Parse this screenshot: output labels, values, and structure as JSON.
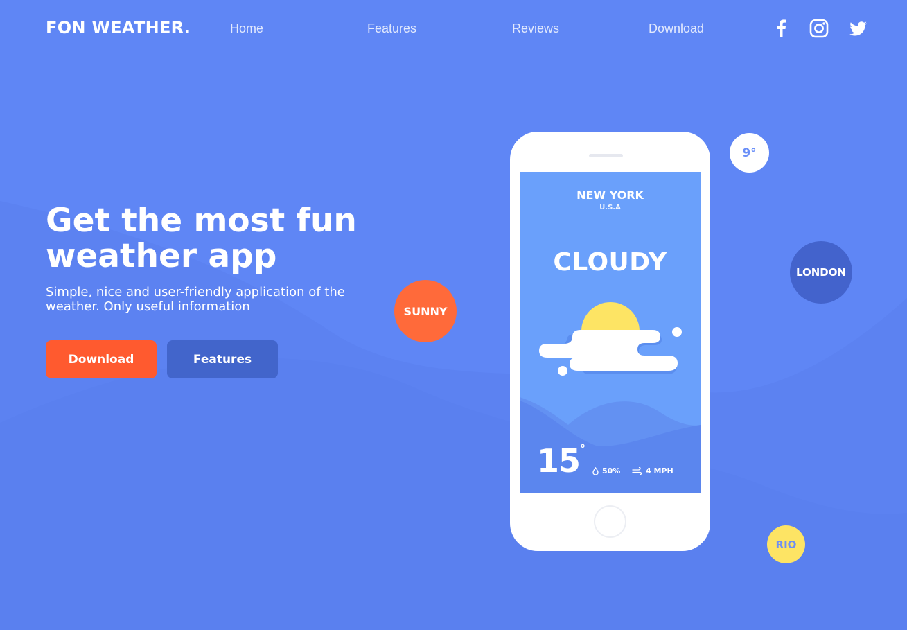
{
  "header": {
    "logo": "FON WEATHER.",
    "nav": [
      {
        "label": "Home"
      },
      {
        "label": "Features"
      },
      {
        "label": "Reviews"
      },
      {
        "label": "Download"
      }
    ],
    "social": [
      {
        "icon": "facebook-icon"
      },
      {
        "icon": "instagram-icon"
      },
      {
        "icon": "twitter-icon"
      }
    ]
  },
  "hero": {
    "title": "Get the most fun weather app",
    "subtitle": "Simple, nice and user-friendly application of the weather. Only useful information",
    "download_label": "Download",
    "features_label": "Features"
  },
  "bubbles": {
    "sunny": "SUNNY",
    "temp": "9°",
    "london": "LONDON",
    "rio": "RIO"
  },
  "phone": {
    "city": "NEW YORK",
    "country": "U.S.A",
    "condition": "CLOUDY",
    "temperature": "15",
    "degree": "°",
    "humidity": "50%",
    "wind": "4 MPH"
  },
  "colors": {
    "background": "#5f86f5",
    "accent_orange": "#ff5a2f",
    "button_blue": "#4265cb",
    "sun_yellow": "#fde464",
    "screen_blue": "#6aa0fb"
  }
}
